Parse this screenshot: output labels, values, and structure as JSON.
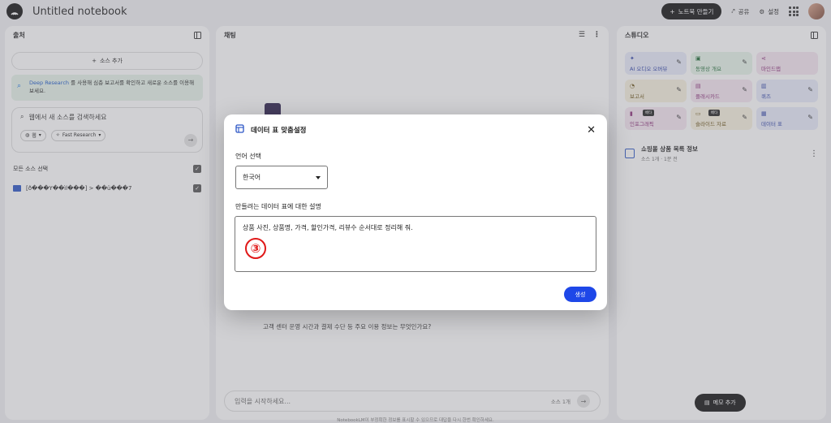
{
  "header": {
    "notebook_title": "Untitled notebook",
    "new_notebook": "노트북 만들기",
    "share": "공유",
    "settings": "설정"
  },
  "sources": {
    "title": "출처",
    "add_source": "소스 추가",
    "deep_research_link": "Deep Research",
    "deep_research_text": "를 사용해 심층 보고서를 확인하고 새로운 소스를 이용해 보세요.",
    "search_placeholder": "웹에서 새 소스를 검색하세요",
    "chip_web": "웹",
    "chip_fast": "Fast Research",
    "select_all": "모든 소스 선택",
    "items": [
      {
        "label": "[ð���Y��ìl���] > ��ü���7"
      }
    ]
  },
  "chat": {
    "title": "채팅",
    "suggested_question": "고객 센터 운영 시간과 결제 수단 등 주요 이용 정보는 무엇인가요?",
    "input_placeholder": "입력을 시작하세요...",
    "source_count": "소스 1개"
  },
  "studio": {
    "title": "스튜디오",
    "tiles": [
      {
        "label": "AI 오디오 오버뷰",
        "color": "blue",
        "icon": "audio-icon"
      },
      {
        "label": "동영상 개요",
        "color": "green",
        "icon": "video-icon"
      },
      {
        "label": "마인드맵",
        "color": "pink",
        "icon": "mindmap-icon"
      },
      {
        "label": "보고서",
        "color": "yellow",
        "icon": "report-icon"
      },
      {
        "label": "플래시카드",
        "color": "pink",
        "icon": "flashcard-icon"
      },
      {
        "label": "퀴즈",
        "color": "blue",
        "icon": "quiz-icon"
      },
      {
        "label": "인포그래픽",
        "color": "pink",
        "icon": "infographic-icon",
        "badge": "베타"
      },
      {
        "label": "슬라이드 자료",
        "color": "yellow",
        "icon": "slides-icon",
        "badge": "베타"
      },
      {
        "label": "데이터 표",
        "color": "blue",
        "icon": "table-icon"
      }
    ],
    "note_title": "쇼핑몰 상품 목록 정보",
    "note_sub": "소스 1개 · 1분 전",
    "memo_button": "메모 추가",
    "footer": "NotebookLM이 부정확한 정보를 표시할 수 있으므로 대답을 다시 한번 확인하세요."
  },
  "modal": {
    "title": "데이터 표 맞춤설정",
    "language_label": "언어 선택",
    "language_value": "한국어",
    "description_label": "만들려는 데이터 표에 대한 설명",
    "description_value": "상품 사진, 상품명, 가격, 할인가격, 리뷰수 순서대로 정리해 줘.",
    "step_marker": "③",
    "generate_button": "생성"
  },
  "colors": {
    "accent": "#1e47e8",
    "annotation": "#e01818"
  }
}
